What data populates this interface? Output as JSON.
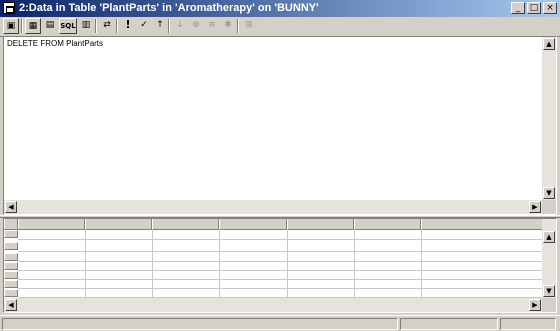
{
  "window": {
    "title": "2:Data in Table 'PlantParts' in 'Aromatherapy' on 'BUNNY'",
    "caption_buttons": [
      "_",
      "□",
      "×"
    ]
  },
  "toolbar": {
    "items": [
      {
        "name": "properties-icon",
        "glyph": "▣",
        "enabled": true
      },
      {
        "name": "diagram-pane-icon",
        "glyph": "▦",
        "enabled": true,
        "pressed": true
      },
      {
        "name": "grid-pane-icon",
        "glyph": "▤",
        "enabled": true
      },
      {
        "name": "sql-pane-icon",
        "glyph": "SQL",
        "enabled": true,
        "pressed": true
      },
      {
        "name": "results-pane-icon",
        "glyph": "▥",
        "enabled": true
      },
      {
        "name": "change-query-type-icon",
        "glyph": "⇄",
        "enabled": true
      },
      {
        "name": "run-icon",
        "glyph": "!",
        "enabled": true
      },
      {
        "name": "verify-sql-icon",
        "glyph": "✓",
        "enabled": true
      },
      {
        "name": "sort-ascending-icon",
        "glyph": "↑",
        "enabled": true
      },
      {
        "name": "sort-descending-icon",
        "glyph": "↓",
        "enabled": false
      },
      {
        "name": "remove-filter-icon",
        "glyph": "⊗",
        "enabled": false
      },
      {
        "name": "group-by-icon",
        "glyph": "≡",
        "enabled": false
      },
      {
        "name": "new-row-icon",
        "glyph": "✱",
        "enabled": false
      },
      {
        "name": "add-table-icon",
        "glyph": "⊞",
        "enabled": false
      }
    ]
  },
  "sql_pane": {
    "text": "DELETE FROM PlantParts"
  },
  "results_grid": {
    "column_headers": [
      "",
      "",
      "",
      "",
      "",
      "",
      ""
    ],
    "row_count": 7
  },
  "status_bar": {
    "panels": [
      "",
      "",
      ""
    ]
  }
}
